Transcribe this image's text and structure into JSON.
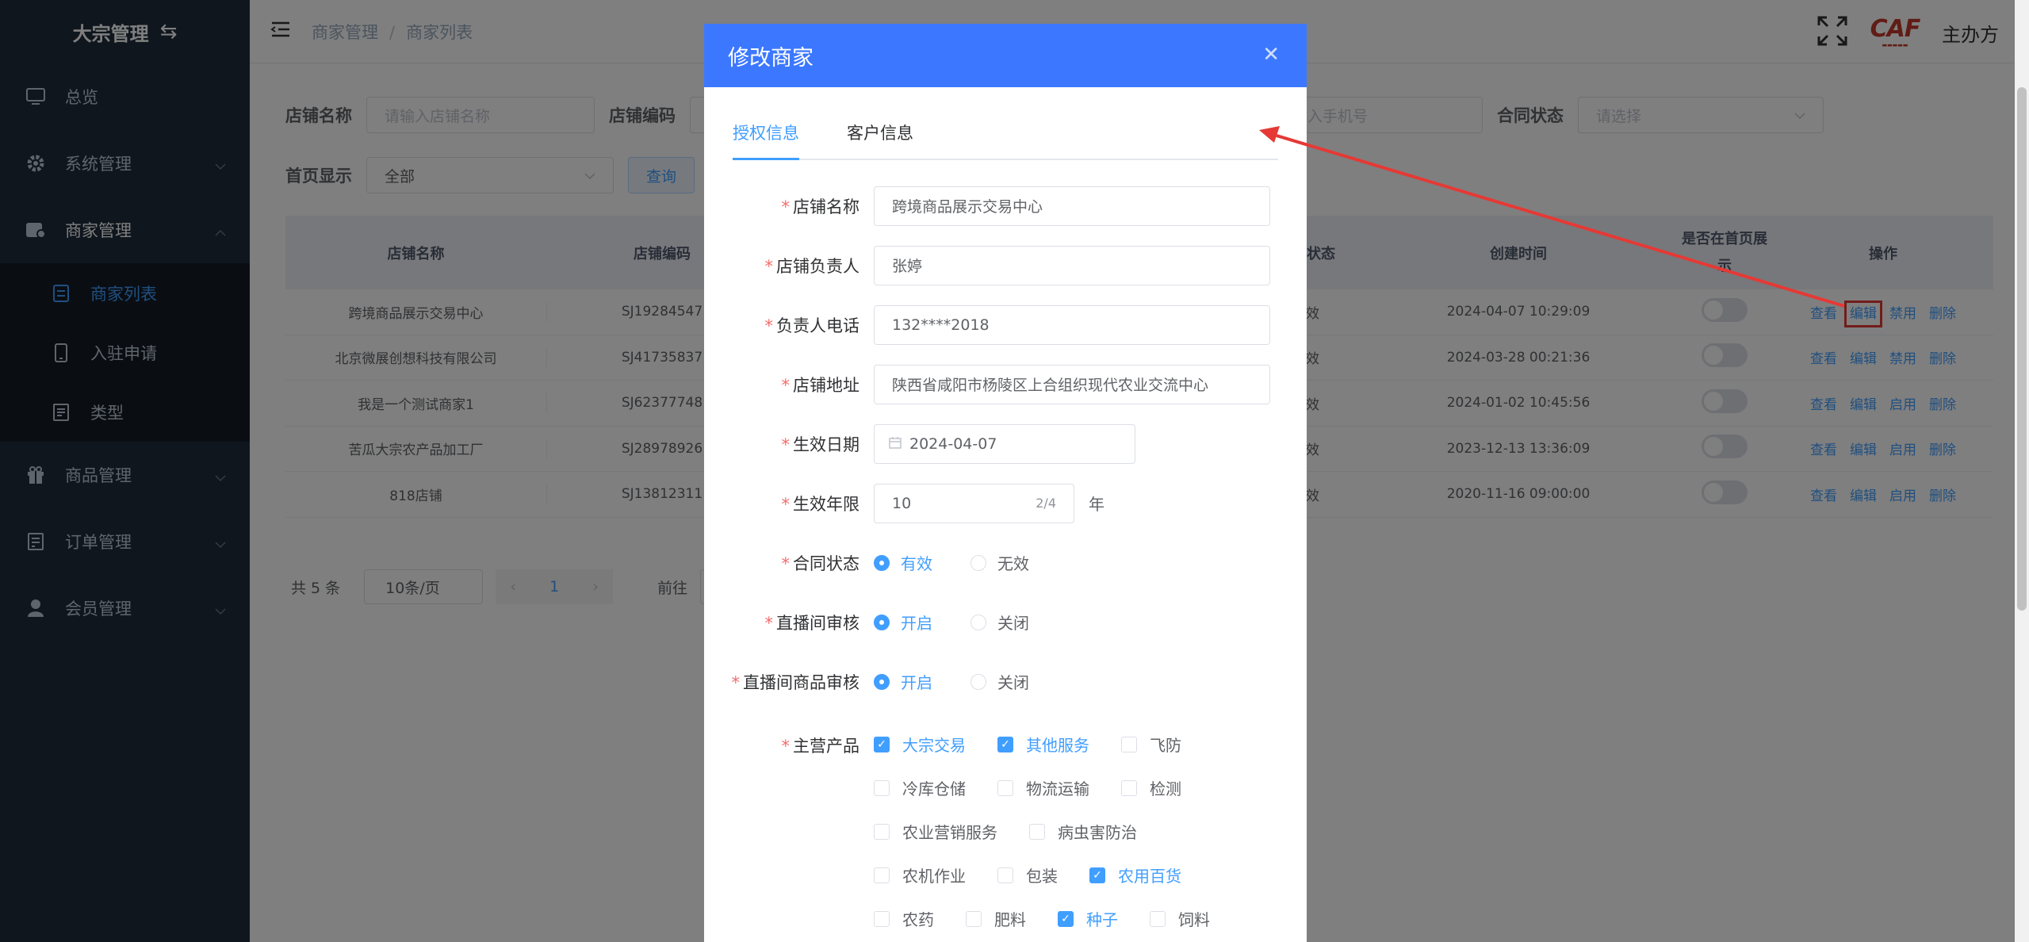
{
  "sidebar": {
    "logo": "大宗管理",
    "items": [
      {
        "label": "总览",
        "icon": "monitor-icon"
      },
      {
        "label": "系统管理",
        "icon": "gear-icon"
      },
      {
        "label": "商家管理",
        "icon": "store-icon"
      },
      {
        "label": "商家列表",
        "icon": "list-icon"
      },
      {
        "label": "入驻申请",
        "icon": "phone-icon"
      },
      {
        "label": "类型",
        "icon": "document-icon"
      },
      {
        "label": "商品管理",
        "icon": "gift-icon"
      },
      {
        "label": "订单管理",
        "icon": "order-icon"
      },
      {
        "label": "会员管理",
        "icon": "user-icon"
      }
    ]
  },
  "header": {
    "breadcrumb": [
      "商家管理",
      "商家列表"
    ],
    "host": "主办方",
    "logo_text": "CAF"
  },
  "filters": {
    "shop_name_label": "店铺名称",
    "shop_name_placeholder": "请输入店铺名称",
    "shop_code_label": "店铺编码",
    "phone_placeholder": "请输入手机号",
    "contract_label": "合同状态",
    "contract_placeholder": "请选择",
    "homepage_label": "首页显示",
    "homepage_value": "全部",
    "query_button": "查询"
  },
  "table": {
    "headers": [
      "店铺名称",
      "店铺编码",
      "同状态",
      "创建时间",
      "是否在首页展示",
      "操作"
    ],
    "rows": [
      {
        "name": "跨境商品展示交易中心",
        "code": "SJ19284547",
        "status": "有效",
        "created": "2024-04-07 10:29:09",
        "ops": [
          "查看",
          "编辑",
          "禁用",
          "删除"
        ]
      },
      {
        "name": "北京微展创想科技有限公司",
        "code": "SJ41735837",
        "status": "有效",
        "created": "2024-03-28 00:21:36",
        "ops": [
          "查看",
          "编辑",
          "禁用",
          "删除"
        ]
      },
      {
        "name": "我是一个测试商家1",
        "code": "SJ62377748",
        "status": "有效",
        "created": "2024-01-02 10:45:56",
        "ops": [
          "查看",
          "编辑",
          "启用",
          "删除"
        ]
      },
      {
        "name": "苦瓜大宗农产品加工厂",
        "code": "SJ28978926",
        "status": "无效",
        "created": "2023-12-13 13:36:09",
        "ops": [
          "查看",
          "编辑",
          "启用",
          "删除"
        ]
      },
      {
        "name": "818店铺",
        "code": "SJ13812311",
        "status": "有效",
        "created": "2020-11-16 09:00:00",
        "ops": [
          "查看",
          "编辑",
          "启用",
          "删除"
        ]
      }
    ]
  },
  "pager": {
    "total": "共 5 条",
    "page_size": "10条/页",
    "current": "1",
    "goto": "前往"
  },
  "dialog": {
    "title": "修改商家",
    "tabs": [
      "授权信息",
      "客户信息"
    ],
    "fields": {
      "shop_name_label": "店铺名称",
      "shop_name": "跨境商品展示交易中心",
      "manager_label": "店铺负责人",
      "manager": "张婷",
      "phone_label": "负责人电话",
      "phone": "132****2018",
      "address_label": "店铺地址",
      "address": "陕西省咸阳市杨陵区上合组织现代农业交流中心",
      "date_label": "生效日期",
      "date": "2024-04-07",
      "years_label": "生效年限",
      "years": "10",
      "years_count": "2/4",
      "years_unit": "年",
      "contract_label": "合同状态",
      "contract_on": "有效",
      "contract_off": "无效",
      "live_label": "直播间审核",
      "live_on": "开启",
      "live_off": "关闭",
      "live_goods_label": "直播间商品审核",
      "live_goods_on": "开启",
      "live_goods_off": "关闭",
      "products_label": "主营产品"
    },
    "products": [
      [
        {
          "label": "大宗交易",
          "checked": true
        },
        {
          "label": "其他服务",
          "checked": true
        },
        {
          "label": "飞防",
          "checked": false
        }
      ],
      [
        {
          "label": "冷库仓储",
          "checked": false
        },
        {
          "label": "物流运输",
          "checked": false
        },
        {
          "label": "检测",
          "checked": false
        }
      ],
      [
        {
          "label": "农业营销服务",
          "checked": false
        },
        {
          "label": "病虫害防治",
          "checked": false
        }
      ],
      [
        {
          "label": "农机作业",
          "checked": false
        },
        {
          "label": "包装",
          "checked": false
        },
        {
          "label": "农用百货",
          "checked": true
        }
      ],
      [
        {
          "label": "农药",
          "checked": false
        },
        {
          "label": "肥料",
          "checked": false
        },
        {
          "label": "种子",
          "checked": true
        },
        {
          "label": "饲料",
          "checked": false
        }
      ]
    ]
  },
  "colors": {
    "sidebar_bg": "#1f2d3d",
    "dialog_header": "#3c78ff",
    "accent": "#409eff",
    "annotation": "#e53935"
  }
}
